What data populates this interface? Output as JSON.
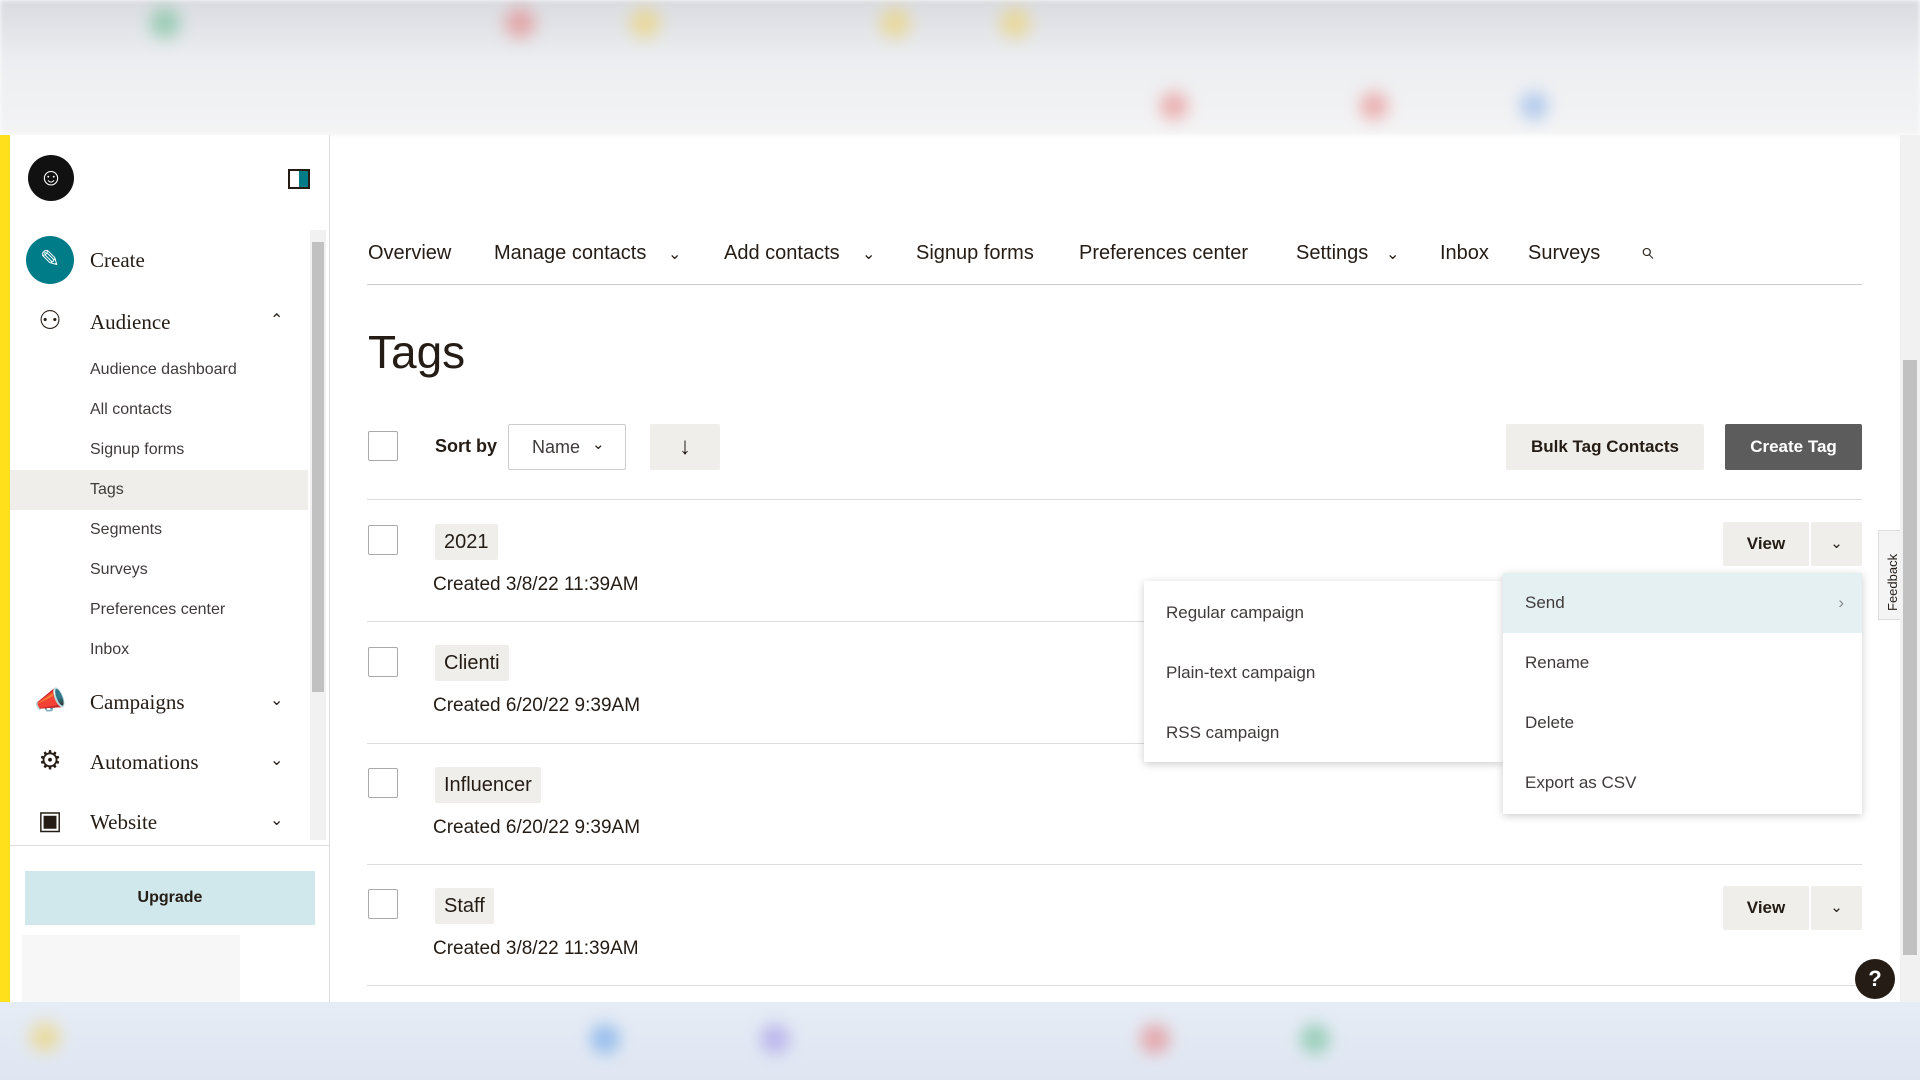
{
  "sidebar": {
    "create": "Create",
    "audience": "Audience",
    "audience_items": [
      "Audience dashboard",
      "All contacts",
      "Signup forms",
      "Tags",
      "Segments",
      "Surveys",
      "Preferences center",
      "Inbox"
    ],
    "active_item": "Tags",
    "campaigns": "Campaigns",
    "automations": "Automations",
    "website": "Website",
    "upgrade": "Upgrade"
  },
  "nav": {
    "items": [
      "Overview",
      "Manage contacts",
      "Add contacts",
      "Signup forms",
      "Preferences center",
      "Settings",
      "Inbox",
      "Surveys"
    ]
  },
  "page": {
    "title": "Tags"
  },
  "toolbar": {
    "sort_by": "Sort by",
    "sort_value": "Name",
    "bulk": "Bulk Tag Contacts",
    "create": "Create Tag"
  },
  "tags": [
    {
      "name": "2021",
      "created": "Created 3/8/22 11:39AM"
    },
    {
      "name": "Clienti",
      "created": "Created 6/20/22 9:39AM"
    },
    {
      "name": "Influencer",
      "created": "Created 6/20/22 9:39AM"
    },
    {
      "name": "Staff",
      "created": "Created 3/8/22 11:39AM"
    }
  ],
  "view_label": "View",
  "row_menu": [
    "Send",
    "Rename",
    "Delete",
    "Export as CSV"
  ],
  "send_submenu": [
    "Regular campaign",
    "Plain-text campaign",
    "RSS campaign"
  ],
  "feedback": "Feedback",
  "help": "?",
  "colors": {
    "brand_yellow": "#ffe01b",
    "teal": "#007c89",
    "dark_button": "#5c5c5c",
    "highlight": "#e5f0f2"
  }
}
